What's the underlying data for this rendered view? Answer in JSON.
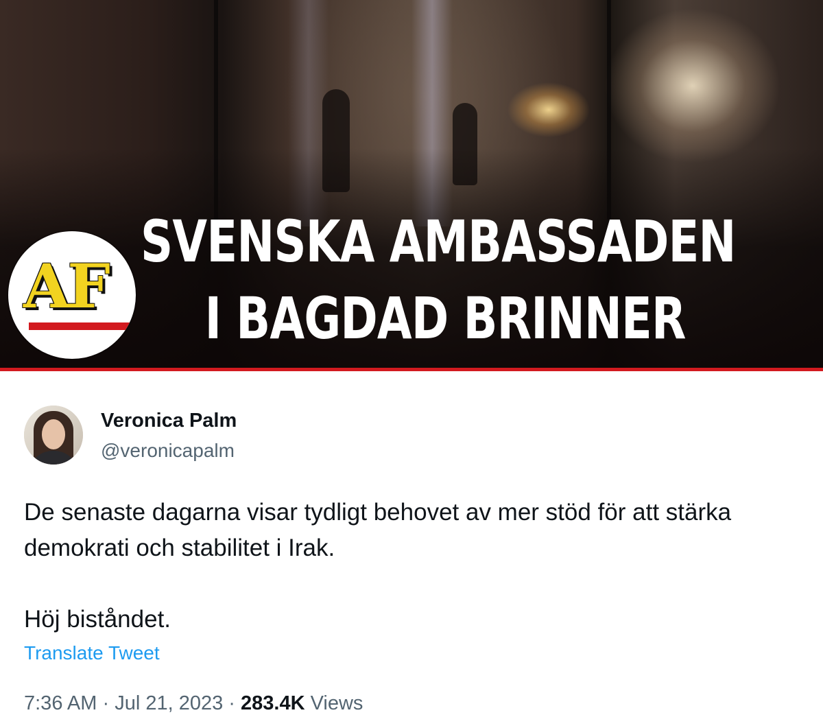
{
  "banner": {
    "headline_line1": "SVENSKA AMBASSADEN",
    "headline_line2": "I BAGDAD BRINNER",
    "logo_text": "AF",
    "accent_color": "#d21a1f",
    "logo_color": "#f2d320"
  },
  "tweet": {
    "author_name": "Veronica Palm",
    "author_handle": "@veronicapalm",
    "text_paragraph_1": "De senaste dagarna visar tydligt behovet av mer stöd för att stärka demokrati och stabilitet  i Irak.",
    "text_paragraph_2": "Höj biståndet.",
    "translate_label": "Translate Tweet",
    "time": "7:36 AM",
    "separator": "·",
    "date": "Jul 21, 2023",
    "views_count": "283.4K",
    "views_label": "Views",
    "link_color": "#1d9bf0"
  }
}
